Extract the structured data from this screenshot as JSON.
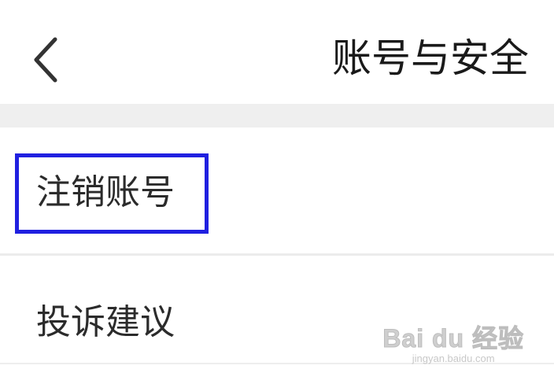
{
  "header": {
    "back_icon": "chevron-left-icon",
    "title": "账号与安全"
  },
  "menu": {
    "items": [
      {
        "label": "注销账号",
        "highlighted": true
      },
      {
        "label": "投诉建议",
        "highlighted": false
      }
    ]
  },
  "annotation": {
    "highlight_color": "#2020e0"
  },
  "watermark": {
    "main": "Bai du 经验",
    "sub": "jingyan.baidu.com"
  }
}
